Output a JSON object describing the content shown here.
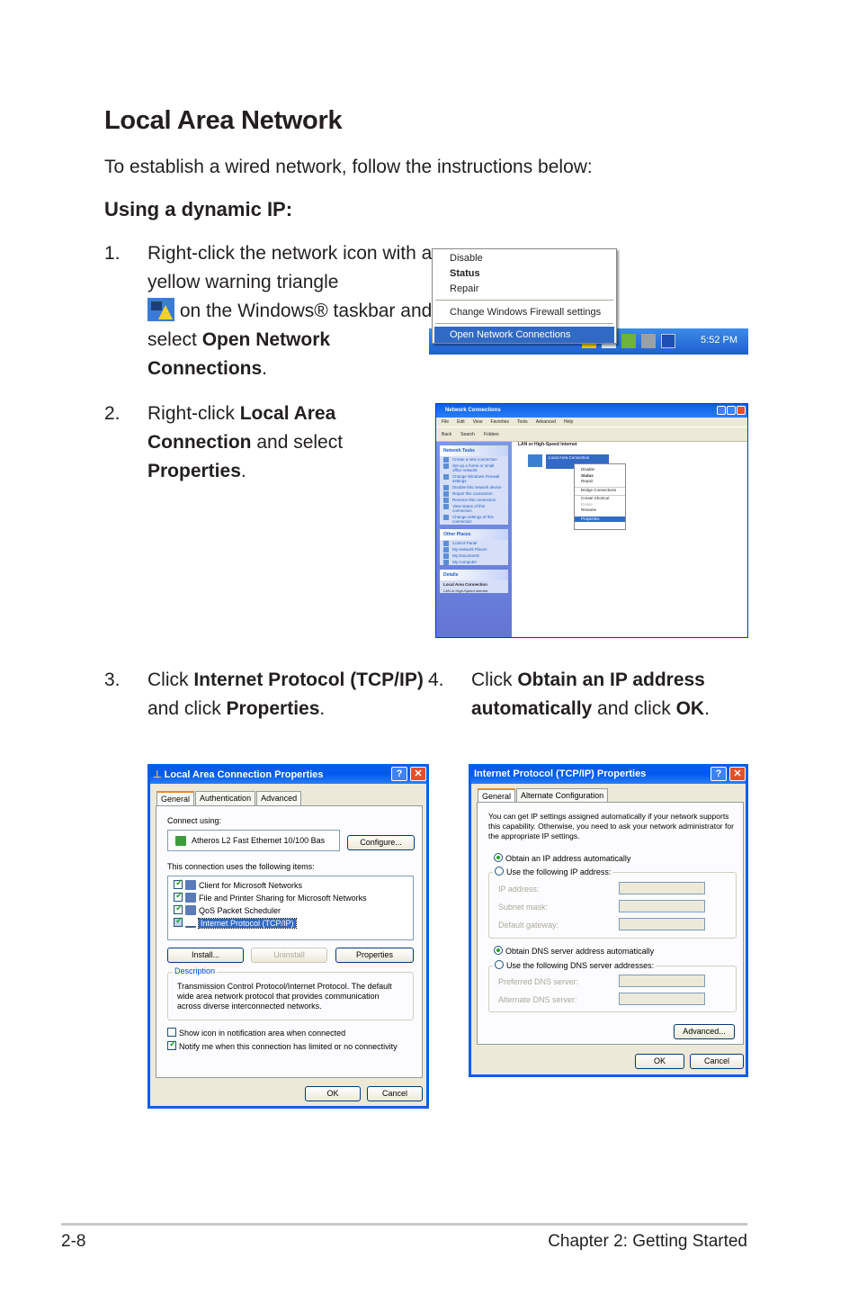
{
  "page": {
    "title": "Local Area Network",
    "intro": "To establish a wired network, follow the instructions below:",
    "subtitle": "Using a dynamic IP:"
  },
  "steps": [
    {
      "num": "1.",
      "parts": [
        "Right-click the network icon with a yellow warning triangle",
        "on the Windows® taskbar and select ",
        "Open Network Connections",
        "."
      ]
    },
    {
      "num": "2.",
      "parts": [
        "Right-click ",
        "Local Area Connection",
        " and select ",
        "Properties",
        "."
      ]
    },
    {
      "num": "3.",
      "parts": [
        "Click ",
        "Internet Protocol (TCP/IP)",
        " and click ",
        "Properties",
        "."
      ]
    },
    {
      "num": "4.",
      "parts": [
        "Click ",
        "Obtain an IP address automatically",
        " and click ",
        "OK",
        "."
      ]
    }
  ],
  "shot1": {
    "menu": [
      "Disable",
      "Status",
      "Repair",
      "Change Windows Firewall settings",
      "Open Network Connections"
    ],
    "clock": "5:52 PM"
  },
  "shot2": {
    "title": "Network Connections",
    "menu": [
      "File",
      "Edit",
      "View",
      "Favorites",
      "Tools",
      "Advanced",
      "Help"
    ],
    "toolbar": [
      "Back",
      "Search",
      "Folders"
    ],
    "network_tasks_title": "Network Tasks",
    "network_tasks": [
      "Create a new connection",
      "Set up a home or small office network",
      "Change Windows Firewall settings",
      "Disable this network device",
      "Repair this connection",
      "Rename this connection",
      "View status of this connection",
      "Change settings of this connection"
    ],
    "other_places_title": "Other Places",
    "other_places": [
      "Control Panel",
      "My Network Places",
      "My Documents",
      "My Computer"
    ],
    "details_title": "Details",
    "details_name": "Local Area Connection",
    "details_type": "LAN or High-Speed Internet",
    "group": "LAN or High-Speed Internet",
    "connection": "Local Area Connection",
    "context_menu": [
      "Disable",
      "Status",
      "Repair",
      "Bridge Connections",
      "Create Shortcut",
      "Delete",
      "Rename",
      "Properties"
    ]
  },
  "dlg1": {
    "title": "Local Area Connection Properties",
    "tabs": [
      "General",
      "Authentication",
      "Advanced"
    ],
    "connect_using": "Connect using:",
    "adapter": "Atheros L2 Fast Ethernet 10/100 Bas",
    "configure": "Configure...",
    "items_label": "This connection uses the following items:",
    "items": [
      {
        "label": "Client for Microsoft Networks",
        "checked": true
      },
      {
        "label": "File and Printer Sharing for Microsoft Networks",
        "checked": true
      },
      {
        "label": "QoS Packet Scheduler",
        "checked": true
      },
      {
        "label": "Internet Protocol (TCP/IP)",
        "checked": true
      }
    ],
    "install": "Install...",
    "uninstall": "Uninstall",
    "properties": "Properties",
    "description_title": "Description",
    "description": "Transmission Control Protocol/Internet Protocol. The default wide area network protocol that provides communication across diverse interconnected networks.",
    "show_icon": "Show icon in notification area when connected",
    "notify": "Notify me when this connection has limited or no connectivity",
    "ok": "OK",
    "cancel": "Cancel"
  },
  "dlg2": {
    "title": "Internet Protocol (TCP/IP) Properties",
    "tabs": [
      "General",
      "Alternate Configuration"
    ],
    "info": "You can get IP settings assigned automatically if your network supports this capability. Otherwise, you need to ask your network administrator for the appropriate IP settings.",
    "obtain_ip": "Obtain an IP address automatically",
    "use_ip": "Use the following IP address:",
    "ip_address": "IP address:",
    "subnet": "Subnet mask:",
    "gateway": "Default gateway:",
    "obtain_dns": "Obtain DNS server address automatically",
    "use_dns": "Use the following DNS server addresses:",
    "pref_dns": "Preferred DNS server:",
    "alt_dns": "Alternate DNS server:",
    "advanced": "Advanced...",
    "ok": "OK",
    "cancel": "Cancel"
  },
  "footer": {
    "page": "2-8",
    "chapter": "Chapter 2: Getting Started"
  }
}
